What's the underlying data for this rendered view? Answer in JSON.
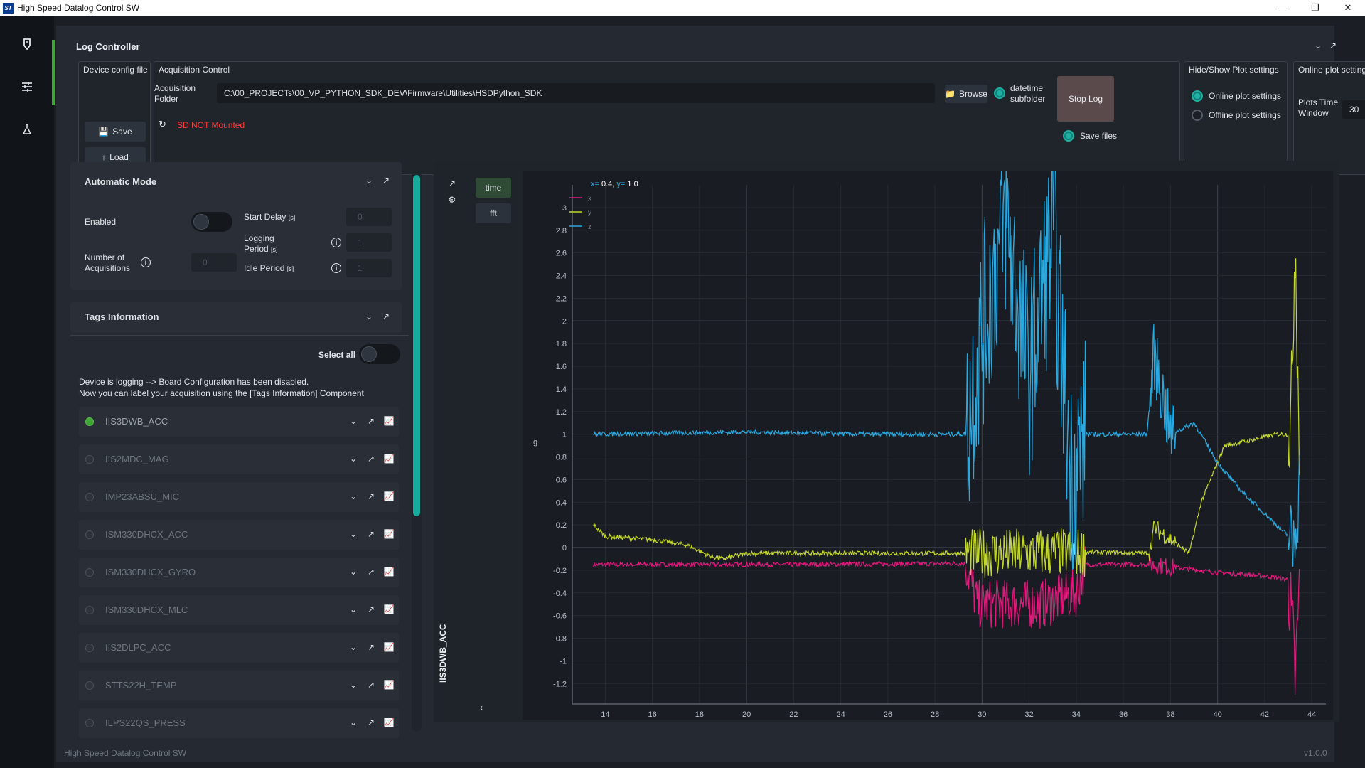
{
  "window": {
    "title": "High Speed Datalog Control SW",
    "logo_text": "ST"
  },
  "log_controller": {
    "title": "Log Controller",
    "device_config": {
      "title": "Device config file",
      "save": "Save",
      "load": "Load"
    },
    "acquisition": {
      "title": "Acquisition Control",
      "folder_label": "Acquisition Folder",
      "folder_path": "C:\\00_PROJECTs\\00_VP_PYTHON_SDK_DEV\\Firmware\\Utilities\\HSDPython_SDK",
      "browse": "Browse",
      "datetime_subfolder": "datetime subfolder",
      "stop_log": "Stop Log",
      "save_files": "Save files",
      "sd_status": "SD NOT Mounted"
    },
    "plot_settings": {
      "title": "Hide/Show Plot settings",
      "online": "Online plot settings",
      "offline": "Offline plot settings"
    },
    "online_plot": {
      "title": "Online plot settings",
      "time_window_label": "Plots Time Window",
      "time_window_value": "30"
    }
  },
  "automatic_mode": {
    "title": "Automatic Mode",
    "enabled_label": "Enabled",
    "num_acq_label": "Number of Acquisitions",
    "num_acq_value": "0",
    "start_delay_label": "Start Delay",
    "logging_period_label": "Logging Period",
    "idle_period_label": "Idle Period",
    "unit": "[s]",
    "start_delay_value": "0",
    "logging_period_value": "1",
    "idle_period_value": "1"
  },
  "tags": {
    "title": "Tags Information",
    "select_all": "Select all",
    "message_line1": "Device is logging --> Board Configuration has been disabled.",
    "message_line2": "Now you can label your acquisition using the [Tags Information] Component"
  },
  "sensors": [
    {
      "name": "IIS3DWB_ACC",
      "active": true
    },
    {
      "name": "IIS2MDC_MAG",
      "active": false
    },
    {
      "name": "IMP23ABSU_MIC",
      "active": false
    },
    {
      "name": "ISM330DHCX_ACC",
      "active": false
    },
    {
      "name": "ISM330DHCX_GYRO",
      "active": false
    },
    {
      "name": "ISM330DHCX_MLC",
      "active": false
    },
    {
      "name": "IIS2DLPC_ACC",
      "active": false
    },
    {
      "name": "STTS22H_TEMP",
      "active": false
    },
    {
      "name": "ILPS22QS_PRESS",
      "active": false
    }
  ],
  "plot": {
    "sensor_label": "IIS3DWB_ACC",
    "mode_time": "time",
    "mode_fft": "fft",
    "cursor_x_label": "x=",
    "cursor_x": "0.4",
    "cursor_y_label": "y=",
    "cursor_y": "1.0"
  },
  "chart_data": {
    "type": "line",
    "ylabel": "g",
    "xlabel": "",
    "xlim": [
      12.6,
      44.6
    ],
    "ylim": [
      -1.38,
      3.2
    ],
    "x_ticks": [
      14,
      16,
      18,
      20,
      22,
      24,
      26,
      28,
      30,
      32,
      34,
      36,
      38,
      40,
      42,
      44
    ],
    "y_ticks": [
      3,
      2.8,
      2.6,
      2.4,
      2.2,
      2,
      1.8,
      1.6,
      1.4,
      1.2,
      1,
      0.8,
      0.6,
      0.4,
      0.2,
      0,
      -0.2,
      -0.4,
      -0.6,
      -0.8,
      -1,
      -1.2
    ],
    "grid_major_x": [
      20,
      30,
      40
    ],
    "grid_major_y": [
      2,
      0
    ],
    "colors": {
      "x": "#e0197d",
      "y": "#c3d62b",
      "z": "#29a9e0"
    },
    "series": [
      {
        "name": "x",
        "x": [
          13.5,
          18,
          22,
          29.3,
          29.8,
          31,
          32.5,
          34,
          34.4,
          37.2,
          38,
          40,
          42,
          43,
          43.2,
          43.3,
          43.5
        ],
        "y": [
          -0.15,
          -0.15,
          -0.15,
          -0.14,
          -0.5,
          -0.5,
          -0.5,
          -0.4,
          -0.15,
          -0.15,
          -0.17,
          -0.22,
          -0.25,
          -0.28,
          -0.8,
          -1.2,
          -0.2
        ]
      },
      {
        "name": "y",
        "x": [
          13.5,
          14,
          16,
          17.5,
          18.5,
          19,
          20,
          25,
          29.3,
          34.4,
          37.1,
          37.3,
          38.8,
          39.3,
          40.3,
          41.5,
          42.5,
          43.1,
          43.3,
          43.5
        ],
        "y": [
          0.2,
          0.1,
          0.07,
          0.02,
          -0.08,
          -0.1,
          -0.05,
          -0.05,
          -0.05,
          -0.04,
          -0.05,
          0.18,
          -0.05,
          0.4,
          0.9,
          0.95,
          1.0,
          1.0,
          2.8,
          0.5
        ]
      },
      {
        "name": "z",
        "x": [
          13.5,
          20,
          25,
          29.3,
          30,
          31,
          32,
          33,
          33.8,
          34.4,
          37,
          37.3,
          38,
          39,
          40,
          41,
          42,
          43,
          43.2,
          43.5
        ],
        "y": [
          1.0,
          1.02,
          1.0,
          1.0,
          1.9,
          2.9,
          1.5,
          2.8,
          0.6,
          1.0,
          1.0,
          1.7,
          1.0,
          1.1,
          0.75,
          0.5,
          0.3,
          0.1,
          0.0,
          0.6
        ]
      }
    ]
  },
  "footer": {
    "app_name": "High Speed Datalog Control SW",
    "version": "v1.0.0"
  }
}
